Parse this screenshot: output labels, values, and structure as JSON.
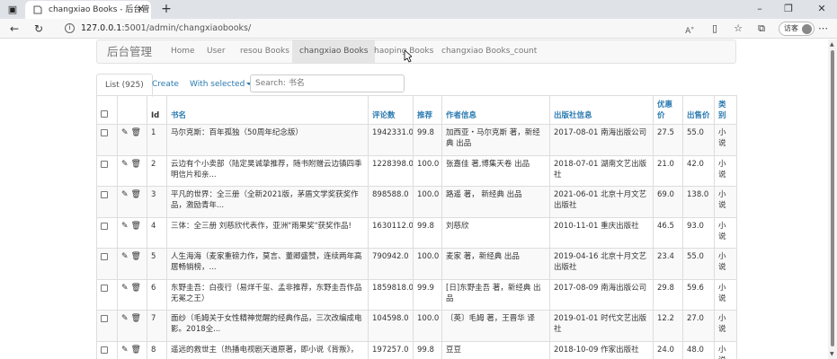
{
  "browser": {
    "tab_title": "changxiao Books - 后台管理",
    "url_host": "127.0.0.1",
    "url_path": ":5001/admin/changxiaobooks/",
    "visitor_label": "访客"
  },
  "navbar": {
    "brand": "后台管理",
    "links": [
      "Home",
      "User",
      "resou Books",
      "changxiao Books",
      "haoping Books",
      "changxiao Books_count"
    ]
  },
  "tabs": {
    "list": "List (925)",
    "create": "Create",
    "with_selected": "With selected"
  },
  "search": {
    "placeholder": "Search: 书名"
  },
  "table": {
    "headers": [
      "Id",
      "书名",
      "评论数",
      "推荐",
      "作者信息",
      "出版社信息",
      "优惠价",
      "出售价",
      "类别"
    ],
    "rows": [
      [
        "1",
        "马尔克斯：百年孤独（50周年纪念版）",
        "1942331.0",
        "99.8",
        "加西亚・马尔克斯 著，新经典 出品",
        "2017-08-01 南海出版公司",
        "27.5",
        "55.0",
        "小说"
      ],
      [
        "2",
        "云边有个小卖部（陆定昊诚挚推荐，随书附赠云边镇四季明信片和亲...",
        "1228398.0",
        "100.0",
        "张嘉佳 著,博集天卷 出品",
        "2018-07-01 湖南文艺出版社",
        "21.0",
        "42.0",
        "小说"
      ],
      [
        "3",
        "平凡的世界：全三册（全新2021版，茅盾文学奖获奖作品，激励青年...",
        "898588.0",
        "100.0",
        "路遥 著， 新经典 出品",
        "2021-06-01 北京十月文艺出版社",
        "69.0",
        "138.0",
        "小说"
      ],
      [
        "4",
        "三体：全三册 刘慈欣代表作，亚洲\"雨果奖\"获奖作品!",
        "1630112.0",
        "99.8",
        "刘慈欣",
        "2010-11-01 重庆出版社",
        "46.5",
        "93.0",
        "小说"
      ],
      [
        "5",
        "人生海海（麦家重磅力作，莫言、董卿盛赞，连续两年高居畅销榜，...",
        "790942.0",
        "100.0",
        "麦家 著，新经典 出品",
        "2019-04-16 北京十月文艺出版社",
        "23.4",
        "55.0",
        "小说"
      ],
      [
        "6",
        "东野圭吾：白夜行（易烊千玺、孟非推荐，东野圭吾作品无冕之王）",
        "1859818.0",
        "99.9",
        "[日]东野圭吾 著，新经典 出品",
        "2017-08-09 南海出版公司",
        "29.8",
        "59.6",
        "小说"
      ],
      [
        "7",
        "面纱（毛姆关于女性精神觉醒的经典作品，三次改编成电影。2018全...",
        "104598.0",
        "100.0",
        "〔英〕毛姆 著，王晋华 译",
        "2019-01-01 时代文艺出版社",
        "12.2",
        "27.0",
        "小说"
      ],
      [
        "8",
        "遥远的救世主（热播电视剧天道原著，即小说《背叛》，",
        "197257.0",
        "99.8",
        "豆豆",
        "2018-10-09 作家出版社",
        "24.0",
        "48.0",
        "小说"
      ]
    ]
  },
  "icons": {
    "edit": "pencil-icon",
    "delete": "trash-icon"
  }
}
